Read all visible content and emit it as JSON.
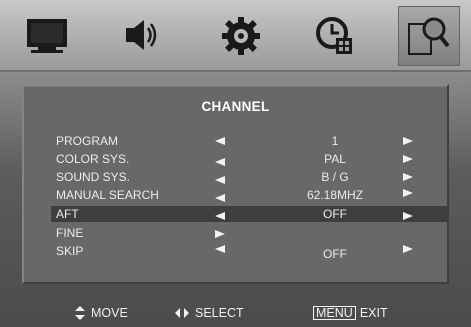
{
  "top_tabs": [
    {
      "icon": "tv-icon"
    },
    {
      "icon": "speaker-icon"
    },
    {
      "icon": "gear-icon"
    },
    {
      "icon": "clock-icon"
    },
    {
      "icon": "channel-search-icon",
      "active": true
    }
  ],
  "panel": {
    "title": "CHANNEL",
    "rows": [
      {
        "label": "PROGRAM",
        "value": "1"
      },
      {
        "label": "COLOR SYS.",
        "value": "PAL"
      },
      {
        "label": "SOUND SYS.",
        "value": "B / G"
      },
      {
        "label": "MANUAL SEARCH",
        "value": "62.18MHZ"
      },
      {
        "label": "AFT",
        "value": "OFF",
        "selected": true
      },
      {
        "label": "FINE",
        "value": ""
      },
      {
        "label": "SKIP",
        "value": "OFF"
      }
    ]
  },
  "hints": {
    "move": "MOVE",
    "select": "SELECT",
    "menu_key": "MENU",
    "exit": "EXIT"
  },
  "colors": {
    "panel": "#686868",
    "selection": "#3e3e3e",
    "text": "#ececec"
  }
}
